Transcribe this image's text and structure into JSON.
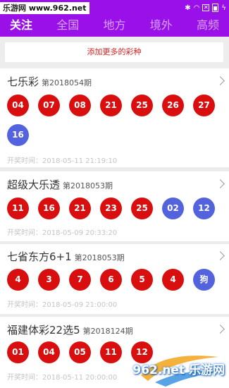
{
  "watermark": {
    "brand": "乐游网",
    "site": "www.962.net"
  },
  "tabs": [
    "关注",
    "全国",
    "地方",
    "境外",
    "高频"
  ],
  "add_button": "添加更多的彩种",
  "lotteries": [
    {
      "name": "七乐彩",
      "issue": "第2018054期",
      "balls": [
        {
          "n": "04",
          "c": "red"
        },
        {
          "n": "07",
          "c": "red"
        },
        {
          "n": "08",
          "c": "red"
        },
        {
          "n": "21",
          "c": "red"
        },
        {
          "n": "25",
          "c": "red"
        },
        {
          "n": "26",
          "c": "red"
        },
        {
          "n": "27",
          "c": "red"
        },
        {
          "n": "16",
          "c": "blue"
        }
      ],
      "time": "开奖时间：2018-05-11 21:19:10"
    },
    {
      "name": "超级大乐透",
      "issue": "第2018053期",
      "balls": [
        {
          "n": "11",
          "c": "red"
        },
        {
          "n": "16",
          "c": "red"
        },
        {
          "n": "21",
          "c": "red"
        },
        {
          "n": "23",
          "c": "red"
        },
        {
          "n": "25",
          "c": "red"
        },
        {
          "n": "02",
          "c": "blue"
        },
        {
          "n": "12",
          "c": "blue"
        }
      ],
      "time": "开奖时间：2018-05-09 20:33:20"
    },
    {
      "name": "七省东方6+1",
      "issue": "第2018053期",
      "balls": [
        {
          "n": "4",
          "c": "red"
        },
        {
          "n": "3",
          "c": "red"
        },
        {
          "n": "7",
          "c": "red"
        },
        {
          "n": "6",
          "c": "red"
        },
        {
          "n": "5",
          "c": "red"
        },
        {
          "n": "4",
          "c": "red"
        },
        {
          "n": "狗",
          "c": "blue"
        }
      ],
      "time": "开奖时间：2018-05-09 21:00:00"
    },
    {
      "name": "福建体彩22选5",
      "issue": "第2018124期",
      "balls": [
        {
          "n": "01",
          "c": "red"
        },
        {
          "n": "04",
          "c": "red"
        },
        {
          "n": "05",
          "c": "red"
        },
        {
          "n": "11",
          "c": "red"
        },
        {
          "n": "12",
          "c": "red"
        }
      ],
      "time": "开奖时间：2018-05-11 20:00:00"
    }
  ],
  "logo_watermark": "962.net 乐游网",
  "colors": {
    "header": "#9a10e8",
    "red_ball": "#d90f0f",
    "blue_ball": "#5263dd",
    "add_text": "#d61f1f"
  }
}
